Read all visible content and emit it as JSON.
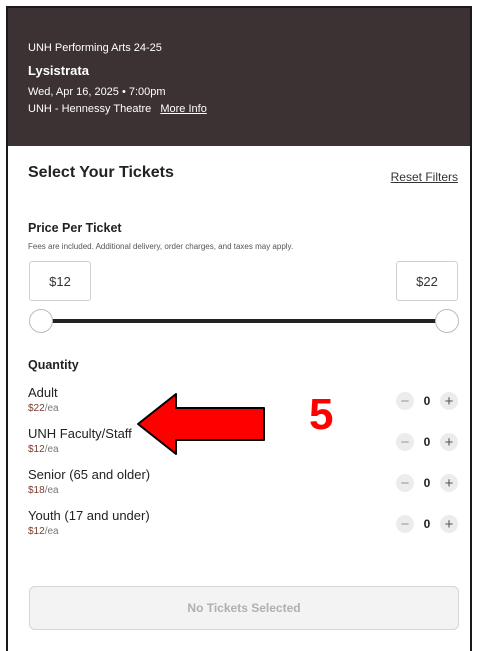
{
  "event": {
    "org": "UNH Performing Arts 24-25",
    "title": "Lysistrata",
    "datetime": "Wed, Apr 16, 2025 • 7:00pm",
    "venue": "UNH - Hennessy Theatre",
    "more_info": "More Info"
  },
  "tickets": {
    "heading": "Select Your Tickets",
    "reset_label": "Reset Filters",
    "price": {
      "label": "Price Per Ticket",
      "fees_note": "Fees are included. Additional delivery, order charges, and taxes may apply.",
      "min": "$12",
      "max": "$22"
    },
    "quantity": {
      "label": "Quantity",
      "types": [
        {
          "name": "Adult",
          "price": "$22",
          "unit": "/ea",
          "count": "0"
        },
        {
          "name": "UNH Faculty/Staff",
          "price": "$12",
          "unit": "/ea",
          "count": "0"
        },
        {
          "name": "Senior (65 and older)",
          "price": "$18",
          "unit": "/ea",
          "count": "0"
        },
        {
          "name": "Youth (17 and under)",
          "price": "$12",
          "unit": "/ea",
          "count": "0"
        }
      ]
    },
    "cta_label": "No Tickets Selected"
  },
  "annotation": {
    "number": "5",
    "color": "#ff0000"
  },
  "icons": {
    "minus": "−",
    "plus": "+"
  }
}
